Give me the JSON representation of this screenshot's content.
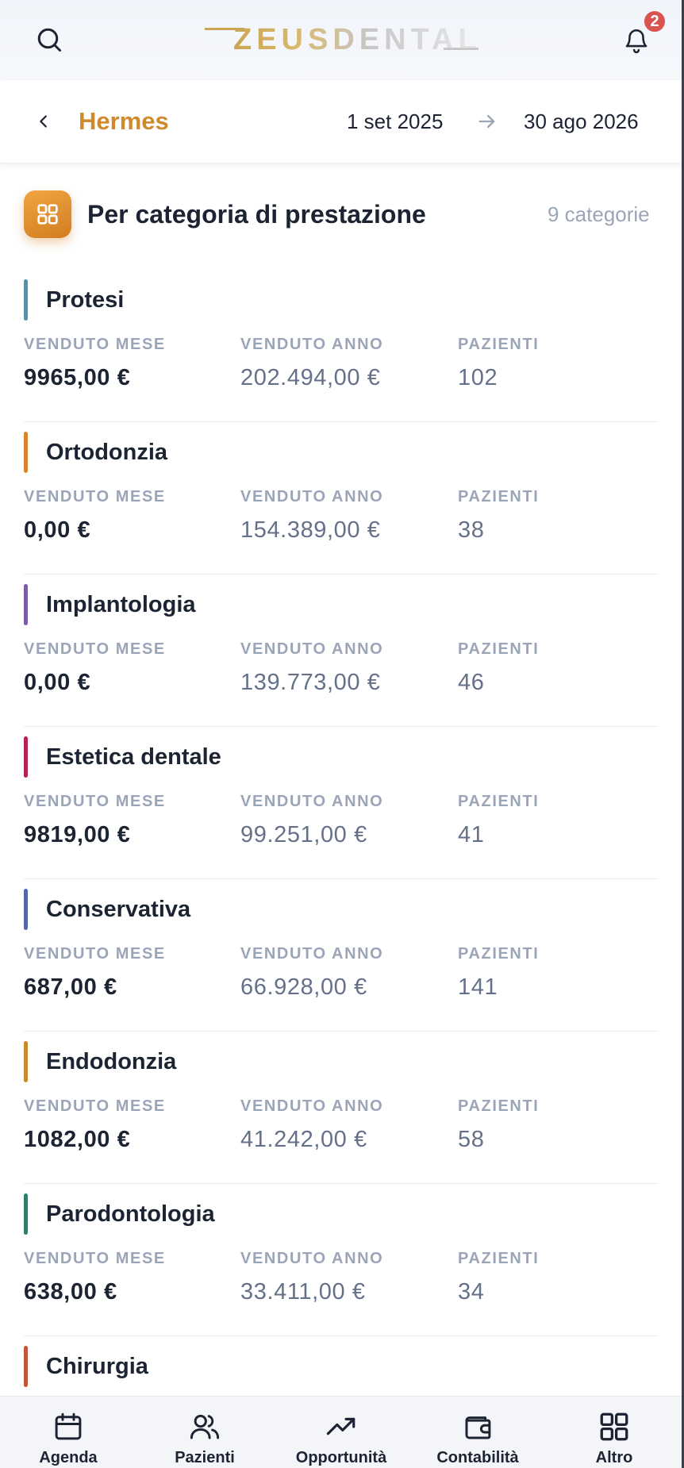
{
  "header": {
    "logo_text": "ZEUSDENTAL",
    "notification_count": "2",
    "icons": [
      "search-icon",
      "bell-icon"
    ]
  },
  "subheader": {
    "title": "Hermes",
    "date_start": "1 set 2025",
    "date_end": "30 ago 2026",
    "icons": [
      "chevron-left-icon",
      "arrow-right-icon"
    ]
  },
  "section": {
    "title": "Per categoria di prestazione",
    "count_label": "9 categorie",
    "icon": "grid-icon",
    "accent": "#d98a2c"
  },
  "columns": {
    "month": "VENDUTO MESE",
    "year": "VENDUTO ANNO",
    "patients": "PAZIENTI"
  },
  "categories": [
    {
      "name": "Protesi",
      "color": "#5b8fa8",
      "month": "9965,00 €",
      "year": "202.494,00 €",
      "patients": "102"
    },
    {
      "name": "Ortodonzia",
      "color": "#d9852d",
      "month": "0,00 €",
      "year": "154.389,00 €",
      "patients": "38"
    },
    {
      "name": "Implantologia",
      "color": "#7b5ba6",
      "month": "0,00 €",
      "year": "139.773,00 €",
      "patients": "46"
    },
    {
      "name": "Estetica dentale",
      "color": "#b8224e",
      "month": "9819,00 €",
      "year": "99.251,00 €",
      "patients": "41"
    },
    {
      "name": "Conservativa",
      "color": "#5567a8",
      "month": "687,00 €",
      "year": "66.928,00 €",
      "patients": "141"
    },
    {
      "name": "Endodonzia",
      "color": "#c88a2a",
      "month": "1082,00 €",
      "year": "41.242,00 €",
      "patients": "58"
    },
    {
      "name": "Parodontologia",
      "color": "#2e7d6b",
      "month": "638,00 €",
      "year": "33.411,00 €",
      "patients": "34"
    },
    {
      "name": "Chirurgia",
      "color": "#c4553a"
    }
  ],
  "nav": {
    "items": [
      {
        "label": "Agenda",
        "icon": "calendar-icon"
      },
      {
        "label": "Pazienti",
        "icon": "users-icon"
      },
      {
        "label": "Opportunità",
        "icon": "trending-up-icon"
      },
      {
        "label": "Contabilità",
        "icon": "wallet-icon"
      },
      {
        "label": "Altro",
        "icon": "grid-icon"
      }
    ]
  }
}
